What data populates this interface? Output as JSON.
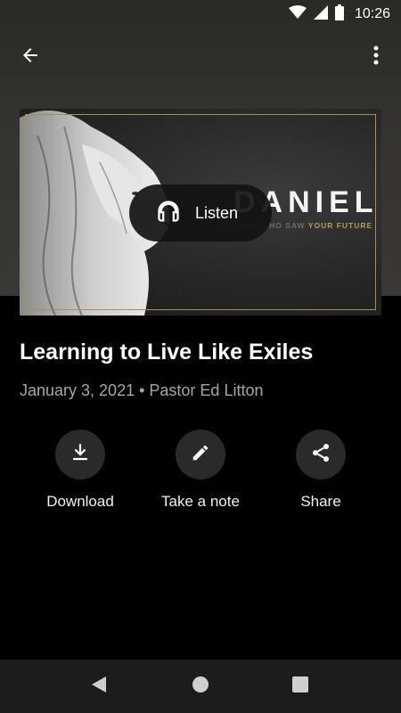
{
  "status_bar": {
    "time": "10:26",
    "icons": [
      "wifi-icon",
      "signal-icon",
      "battery-icon"
    ]
  },
  "app_bar": {
    "back_icon": "arrow-back-icon",
    "menu_icon": "more-vert-icon"
  },
  "artwork": {
    "series_title": "DANIEL",
    "subtitle_prefix": "THE MAN WHO SAW ",
    "subtitle_highlight": "YOUR FUTURE",
    "frame_color": "#a88e55",
    "highlight_color": "#b89a5a"
  },
  "listen_button": {
    "icon": "headphones-icon",
    "label": "Listen"
  },
  "sermon": {
    "title": "Learning to Live Like Exiles",
    "meta": "January 3, 2021 • Pastor Ed Litton"
  },
  "actions": [
    {
      "icon": "download-icon",
      "label": "Download"
    },
    {
      "icon": "pencil-icon",
      "label": "Take a note"
    },
    {
      "icon": "share-icon",
      "label": "Share"
    }
  ],
  "nav_bar": {
    "icons": [
      "nav-back-icon",
      "nav-home-icon",
      "nav-recents-icon"
    ]
  }
}
